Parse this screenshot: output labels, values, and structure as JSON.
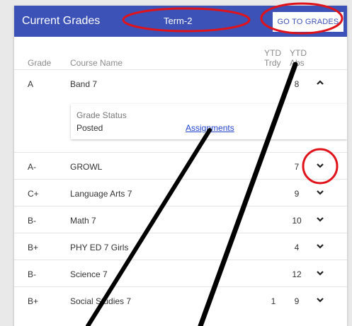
{
  "header": {
    "title": "Current Grades",
    "term": "Term-2",
    "goto_label": "GO TO GRADES"
  },
  "columns": {
    "grade": "Grade",
    "course": "Course Name",
    "ytd_trdy_1": "YTD",
    "ytd_trdy_2": "Trdy",
    "ytd_abs_1": "YTD",
    "ytd_abs_2": "Abs"
  },
  "expanded": {
    "status_label": "Grade Status",
    "status_value": "Posted",
    "assignments_link": "Assignments"
  },
  "rows": [
    {
      "grade": "A",
      "course": "Band 7",
      "trdy": "",
      "abs": "8"
    },
    {
      "grade": "A-",
      "course": "GROWL",
      "trdy": "",
      "abs": "7"
    },
    {
      "grade": "C+",
      "course": "Language Arts 7",
      "trdy": "",
      "abs": "9"
    },
    {
      "grade": "B-",
      "course": "Math 7",
      "trdy": "",
      "abs": "10"
    },
    {
      "grade": "B+",
      "course": "PHY ED 7 Girls",
      "trdy": "",
      "abs": "4"
    },
    {
      "grade": "B-",
      "course": "Science 7",
      "trdy": "",
      "abs": "12"
    },
    {
      "grade": "B+",
      "course": "Social Studies 7",
      "trdy": "1",
      "abs": "9"
    }
  ],
  "colors": {
    "header_bg": "#3d52b7",
    "annotation": "#e0131b"
  }
}
